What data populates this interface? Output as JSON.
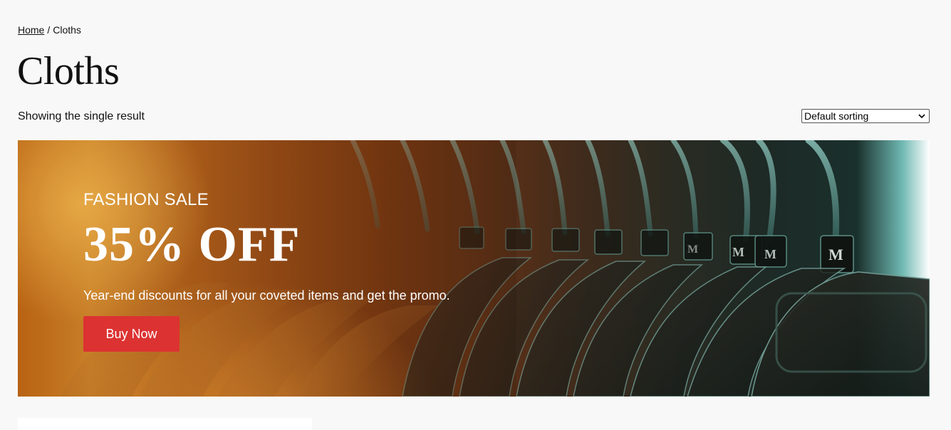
{
  "breadcrumb": {
    "home": "Home",
    "separator": "/",
    "current": "Cloths"
  },
  "page": {
    "title": "Cloths",
    "result_count": "Showing the single result"
  },
  "sort": {
    "selected": "Default sorting"
  },
  "banner": {
    "eyebrow": "FASHION SALE",
    "headline": "35% OFF",
    "text": "Year-end discounts for all your coveted items and get the promo.",
    "button_label": "Buy Now",
    "tag_letter": "M",
    "button_color": "#dc3232"
  },
  "colors": {
    "background": "#f8f8f8",
    "accent": "#dc3232"
  }
}
